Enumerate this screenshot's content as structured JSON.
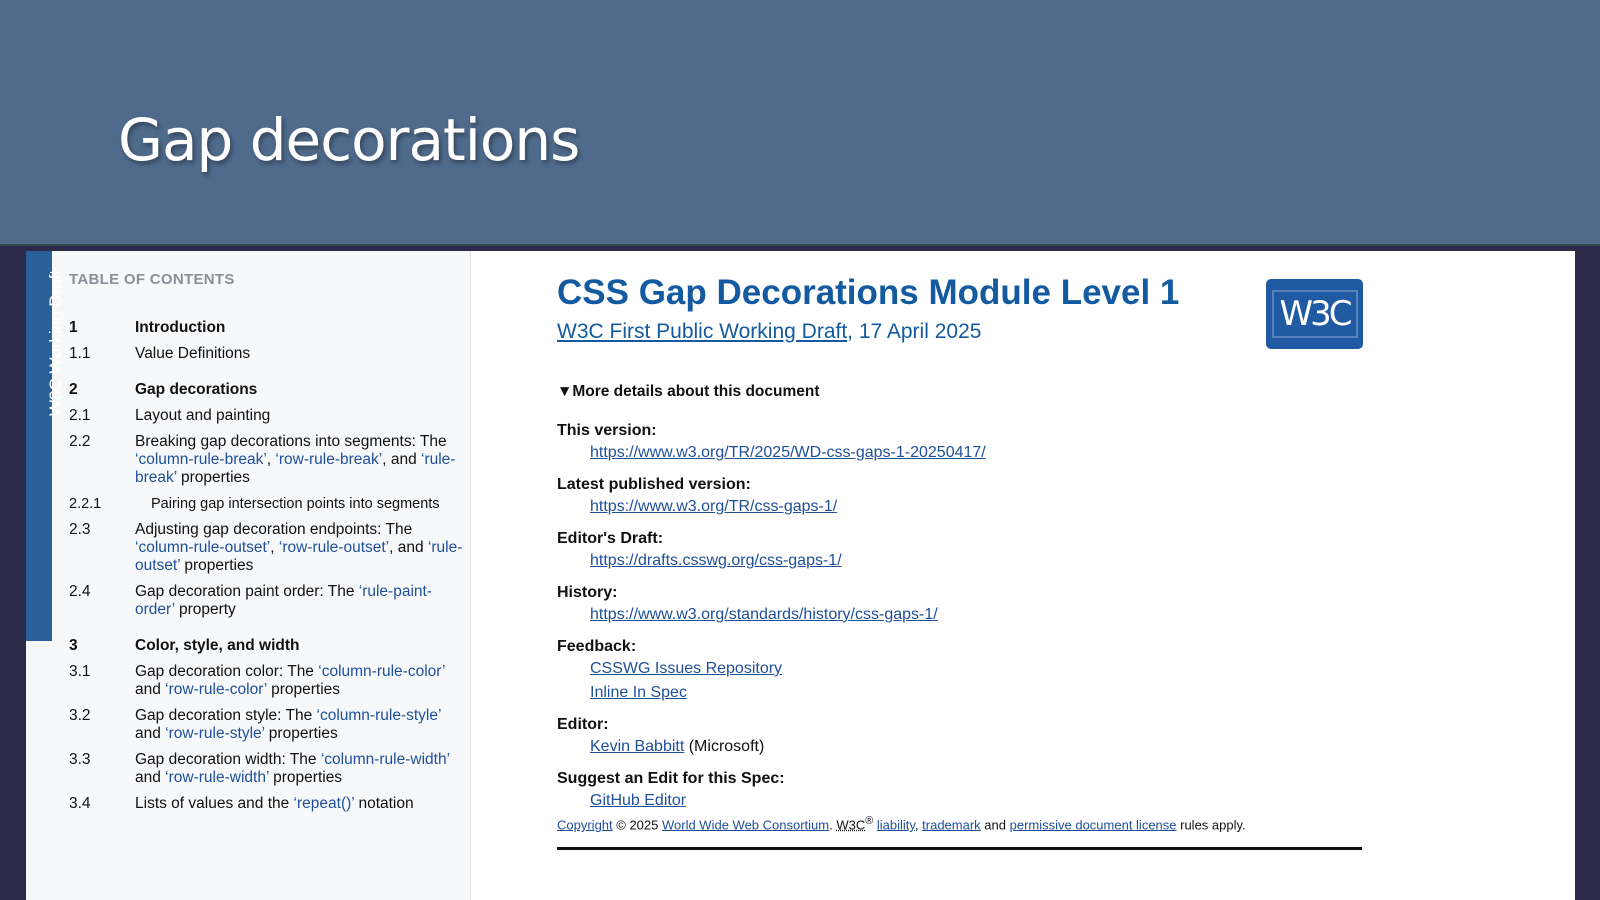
{
  "slide": {
    "title": "Gap decorations"
  },
  "toc": {
    "ribbon": "W3C Working Draft",
    "heading": "TABLE OF CONTENTS",
    "entries": [
      {
        "num": "1",
        "text": "Introduction",
        "level": "major"
      },
      {
        "num": "1.1",
        "text": "Value Definitions",
        "level": "sub"
      },
      {
        "num": "2",
        "text": "Gap decorations",
        "level": "major"
      },
      {
        "num": "2.1",
        "text": "Layout and painting",
        "level": "sub"
      },
      {
        "num": "2.2",
        "parts": [
          "Breaking gap decorations into segments: The ",
          {
            "link": "‘column-rule-break’"
          },
          ", ",
          {
            "link": "‘row-rule-break’"
          },
          ", and ",
          {
            "link": "‘rule-break’"
          },
          " properties"
        ],
        "level": "sub"
      },
      {
        "num": "2.2.1",
        "text": "Pairing gap intersection points into segments",
        "level": "sub3"
      },
      {
        "num": "2.3",
        "parts": [
          "Adjusting gap decoration endpoints: The ",
          {
            "link": "‘column-rule-outset’"
          },
          ", ",
          {
            "link": "‘row-rule-outset’"
          },
          ", and ",
          {
            "link": "‘rule-outset’"
          },
          " properties"
        ],
        "level": "sub"
      },
      {
        "num": "2.4",
        "parts": [
          "Gap decoration paint order: The ",
          {
            "link": "‘rule-paint-order’"
          },
          " property"
        ],
        "level": "sub"
      },
      {
        "num": "3",
        "text": "Color, style, and width",
        "level": "major"
      },
      {
        "num": "3.1",
        "parts": [
          "Gap decoration color: The ",
          {
            "link": "‘column-rule-color’"
          },
          " and ",
          {
            "link": "‘row-rule-color’"
          },
          " properties"
        ],
        "level": "sub"
      },
      {
        "num": "3.2",
        "parts": [
          "Gap decoration style: The ",
          {
            "link": "‘column-rule-style’"
          },
          " and ",
          {
            "link": "‘row-rule-style’"
          },
          " properties"
        ],
        "level": "sub"
      },
      {
        "num": "3.3",
        "parts": [
          "Gap decoration width: The ",
          {
            "link": "‘column-rule-width’"
          },
          " and ",
          {
            "link": "‘row-rule-width’"
          },
          " properties"
        ],
        "level": "sub"
      },
      {
        "num": "3.4",
        "parts": [
          "Lists of values and the ",
          {
            "link": "‘repeat()’"
          },
          " notation"
        ],
        "level": "sub"
      }
    ]
  },
  "doc": {
    "title": "CSS Gap Decorations Module Level 1",
    "subtitle_link": "W3C First Public Working Draft",
    "subtitle_date": ", 17 April 2025",
    "logo": "W3C",
    "details_summary": "▼More details about this document",
    "details": [
      {
        "term": "This version:",
        "values": [
          {
            "link": "https://www.w3.org/TR/2025/WD-css-gaps-1-20250417/"
          }
        ]
      },
      {
        "term": "Latest published version:",
        "values": [
          {
            "link": "https://www.w3.org/TR/css-gaps-1/"
          }
        ]
      },
      {
        "term": "Editor's Draft:",
        "values": [
          {
            "link": "https://drafts.csswg.org/css-gaps-1/"
          }
        ]
      },
      {
        "term": "History:",
        "values": [
          {
            "link": "https://www.w3.org/standards/history/css-gaps-1/"
          }
        ]
      },
      {
        "term": "Feedback:",
        "values": [
          {
            "link": "CSSWG Issues Repository"
          },
          {
            "link": "Inline In Spec"
          }
        ]
      },
      {
        "term": "Editor:",
        "values": [
          {
            "link": "Kevin Babbitt",
            "suffix": " (Microsoft)"
          }
        ]
      },
      {
        "term": "Suggest an Edit for this Spec:",
        "values": [
          {
            "link": "GitHub Editor"
          }
        ]
      }
    ],
    "copyright": [
      {
        "link": "Copyright"
      },
      " © 2025 ",
      {
        "link": "World Wide Web Consortium"
      },
      ". ",
      {
        "abbr": "W3C"
      },
      {
        "sup": "®"
      },
      " ",
      {
        "link": "liability"
      },
      ", ",
      {
        "link": "trademark"
      },
      " and ",
      {
        "link": "permissive document license"
      },
      " rules apply."
    ]
  }
}
